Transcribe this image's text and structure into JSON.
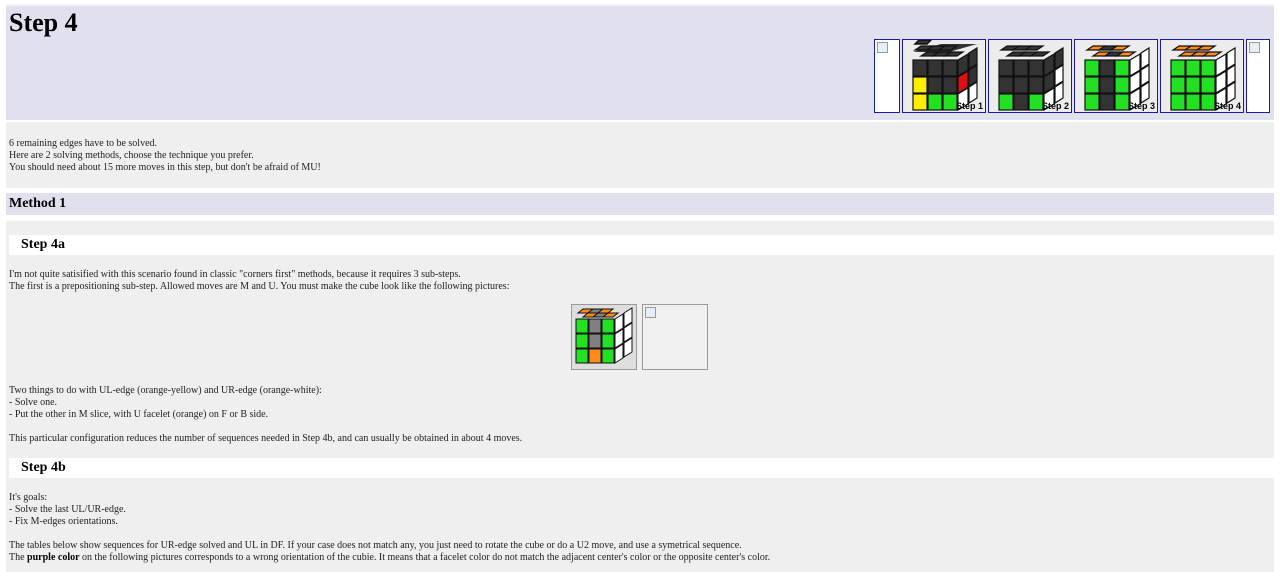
{
  "header": {
    "title": "Step 4",
    "thumbnails": [
      {
        "label": ""
      },
      {
        "label": "Step 1"
      },
      {
        "label": "Step 2"
      },
      {
        "label": "Step 3"
      },
      {
        "label": "Step 4"
      },
      {
        "label": ""
      }
    ]
  },
  "intro": {
    "line1": "6 remaining edges have to be solved.",
    "line2": "Here are 2 solving methods, choose the technique you prefer.",
    "line3": "You should need about 15 more moves in this step, but don't be afraid of MU!"
  },
  "method1": {
    "title": "Method 1",
    "step4a": {
      "title": "Step 4a",
      "p1": "I'm not quite satisified with this scenario found in classic \"corners first\" methods, because it requires 3 sub-steps.",
      "p2": "The first is a prepositioning sub-step. Allowed moves are M and U. You must make the cube look like the following pictures:",
      "p3": "Two things to do with UL-edge (orange-yellow) and UR-edge (orange-white):",
      "p4": "- Solve one.",
      "p5": "- Put the other in M slice, with U facelet (orange) on F or B side.",
      "p6": "This particular configuration reduces the number of sequences needed in Step 4b, and can usually be obtained in about 4 moves."
    },
    "step4b": {
      "title": "Step 4b",
      "p1": "It's goals:",
      "p2": "- Solve the last UL/UR-edge.",
      "p3": "- Fix M-edges orientations.",
      "p4": "The tables below show sequences for UR-edge solved and UL in DF. If your case does not match any, you just need to rotate the cube or do a U2 move, and use a symetrical sequence.",
      "p5_pre": "The ",
      "p5_bold": "purple color",
      "p5_post": " on the following pictures corresponds to a wrong orientation of the cubie. It means that a facelet color do not match the adjacent center's color or the opposite center's color."
    }
  },
  "colors": {
    "header_bg": "#e0e0ef",
    "panel_bg": "#efefef",
    "thumb_border": "#1a1aa8",
    "cube_black": "#333333",
    "cube_green": "#22e022",
    "cube_orange": "#ff8a1a",
    "cube_yellow": "#ffee00",
    "cube_white": "#ffffff",
    "cube_red": "#e01010",
    "cube_grey": "#808080"
  }
}
